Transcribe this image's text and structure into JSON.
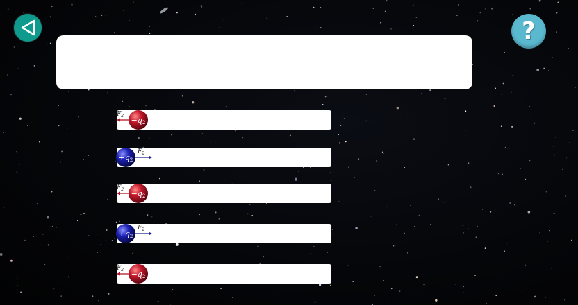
{
  "toolbar": {
    "back_icon": "back-triangle-icon",
    "help_icon": "question-mark-icon",
    "help_glyph": "?"
  },
  "prompt": {
    "text": ""
  },
  "options": [
    {
      "charge": "negative",
      "sign": "−",
      "charge_label": "q",
      "charge_sub": "2",
      "force_label": "F",
      "force_sub": "2",
      "force_direction": "left"
    },
    {
      "charge": "positive",
      "sign": "+",
      "charge_label": "q",
      "charge_sub": "2",
      "force_label": "F",
      "force_sub": "2",
      "force_direction": "right"
    },
    {
      "charge": "negative",
      "sign": "−",
      "charge_label": "q",
      "charge_sub": "2",
      "force_label": "F",
      "force_sub": "2",
      "force_direction": "left"
    },
    {
      "charge": "positive",
      "sign": "+",
      "charge_label": "q",
      "charge_sub": "2",
      "force_label": "F",
      "force_sub": "2",
      "force_direction": "right"
    },
    {
      "charge": "negative",
      "sign": "−",
      "charge_label": "q",
      "charge_sub": "2",
      "force_label": "F",
      "force_sub": "2",
      "force_direction": "left"
    }
  ],
  "colors": {
    "back_button": "#0e9a8c",
    "help_button": "#5ab8cf",
    "negative_charge": "#c0182a",
    "positive_charge": "#1a1fb0",
    "negative_arrow": "#b01a2a",
    "positive_arrow": "#1a1f8a"
  }
}
